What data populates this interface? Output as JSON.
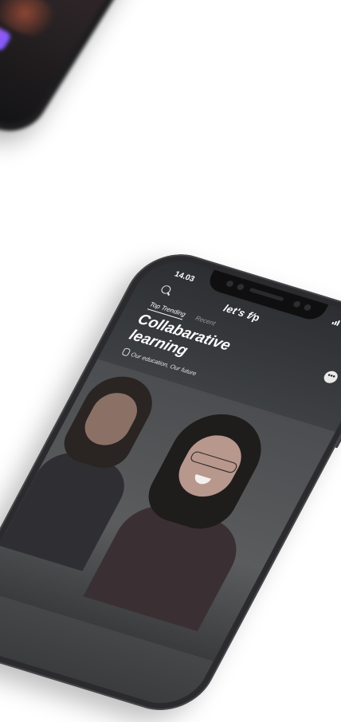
{
  "status": {
    "time": "14.03"
  },
  "app": {
    "brand": "let's f",
    "brand_mark": "∕p"
  },
  "tabs": [
    {
      "label": "Top Trending"
    },
    {
      "label": "Recent"
    }
  ],
  "feature": {
    "title_line1": "Collabarative",
    "title_line2": "learning",
    "subtitle": "Our education, Our future",
    "more_label": "•••"
  },
  "colors": {
    "accent_pink": "#ff4fb3",
    "accent_purple": "#7b5cff",
    "phone_body": "#2b2b2e"
  },
  "icons": [
    "search-icon",
    "more-icon",
    "signal-icon",
    "wifi-icon",
    "battery-icon",
    "clip-icon"
  ]
}
